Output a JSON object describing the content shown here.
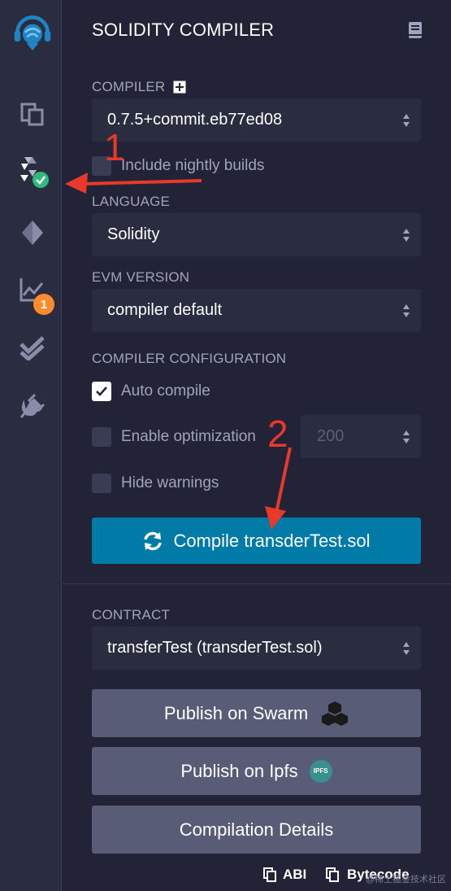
{
  "app": {
    "title": "SOLIDITY COMPILER"
  },
  "sidebar": {
    "icons": [
      "remix-logo-icon",
      "file-explorer-icon",
      "solidity-compiler-icon",
      "deploy-run-icon",
      "analysis-icon",
      "testing-icon",
      "plugin-manager-icon"
    ],
    "analysis_badge": "1",
    "compiler_status": "success",
    "accent_color": "#2fbb7a"
  },
  "compiler": {
    "label": "COMPILER",
    "version": "0.7.5+commit.eb77ed08",
    "nightly_label": "Include nightly builds",
    "nightly_checked": false
  },
  "language": {
    "label": "LANGUAGE",
    "value": "Solidity"
  },
  "evm": {
    "label": "EVM VERSION",
    "value": "compiler default"
  },
  "config": {
    "label": "COMPILER CONFIGURATION",
    "auto_compile_label": "Auto compile",
    "auto_compile_checked": true,
    "optimization_label": "Enable optimization",
    "optimization_checked": false,
    "optimization_runs": "200",
    "hide_warnings_label": "Hide warnings",
    "hide_warnings_checked": false
  },
  "compile_button": {
    "label": "Compile transderTest.sol",
    "color": "#007aa6"
  },
  "contract": {
    "label": "CONTRACT",
    "value": "transferTest (transderTest.sol)"
  },
  "actions": {
    "swarm": "Publish on Swarm",
    "ipfs": "Publish on Ipfs",
    "ipfs_logo_text": "IPFS",
    "details": "Compilation Details"
  },
  "footer": {
    "abi": "ABI",
    "bytecode": "Bytecode"
  },
  "annotations": {
    "step1": "1",
    "step2": "2",
    "color": "#e8392b"
  },
  "watermark": "@稀土掘金技术社区"
}
